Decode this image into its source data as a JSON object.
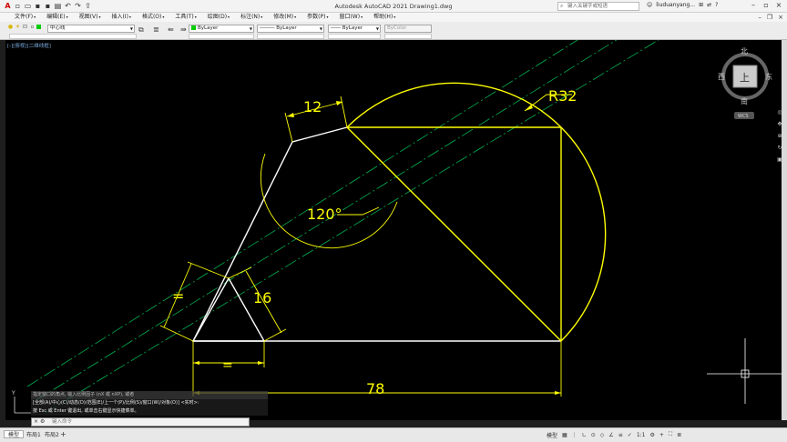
{
  "titlebar": {
    "app_title": "Autodesk AutoCAD 2021    Drawing1.dwg",
    "search_placeholder": "键入关键字或短语",
    "user": "liuduanyang...",
    "quick_access_icons": [
      "new-icon",
      "open-icon",
      "save-icon",
      "saveas-icon",
      "print-icon",
      "undo-icon",
      "redo-icon",
      "share-icon"
    ]
  },
  "menubar": {
    "items": [
      "文件(F)",
      "编辑(E)",
      "视图(V)",
      "插入(I)",
      "格式(O)",
      "工具(T)",
      "绘图(D)",
      "标注(N)",
      "修改(M)",
      "参数(P)",
      "窗口(W)",
      "帮助(H)"
    ]
  },
  "toolbar": {
    "layer_current": "中心线",
    "color_combo": "ByLayer",
    "linetype_combo": "ByLayer",
    "lineweight_combo": "ByLayer",
    "plotstyle_combo": "ByColor",
    "layer_color": "#00cc00",
    "color_swatch": "#00cc00"
  },
  "canvas": {
    "view_label": "[-][俯视][二维线框]",
    "dimensions": {
      "top_width": "12",
      "radius": "R32",
      "angle": "120°",
      "equal_left": "=",
      "equal_bottom": "=",
      "height_16": "16",
      "bottom_length": "78"
    },
    "geometry_color": "#ffff00",
    "line_color": "#ffffff",
    "center_line_color": "#00b050"
  },
  "viewcube": {
    "north": "北",
    "south": "南",
    "east": "东",
    "west": "西",
    "face": "上",
    "wcs": "WCS"
  },
  "commandline": {
    "history": [
      "指定窗口的角点, 输入比例因子 (nX 或 nXP), 或者",
      "[全部(A)/中心(C)/动态(D)/范围(E)/上一个(P)/比例(S)/窗口(W)/对象(O)] <实时>:",
      "按 Esc 或 Enter 键退出, 或单击右键显示快捷菜单。"
    ],
    "input_placeholder": "键入命令"
  },
  "layout_tabs": {
    "items": [
      "模型",
      "布局1",
      "布局2"
    ],
    "active": 0
  },
  "statusbar": {
    "model_label": "模型",
    "scale": "1:1",
    "items": [
      "grid-icon",
      "snap-icon",
      "ortho-icon",
      "polar-icon",
      "osnap-icon",
      "otrack-icon",
      "lineweight-icon",
      "annotation-icon",
      "workspace-icon",
      "settings-icon",
      "fullscreen-icon",
      "customize-icon"
    ]
  }
}
